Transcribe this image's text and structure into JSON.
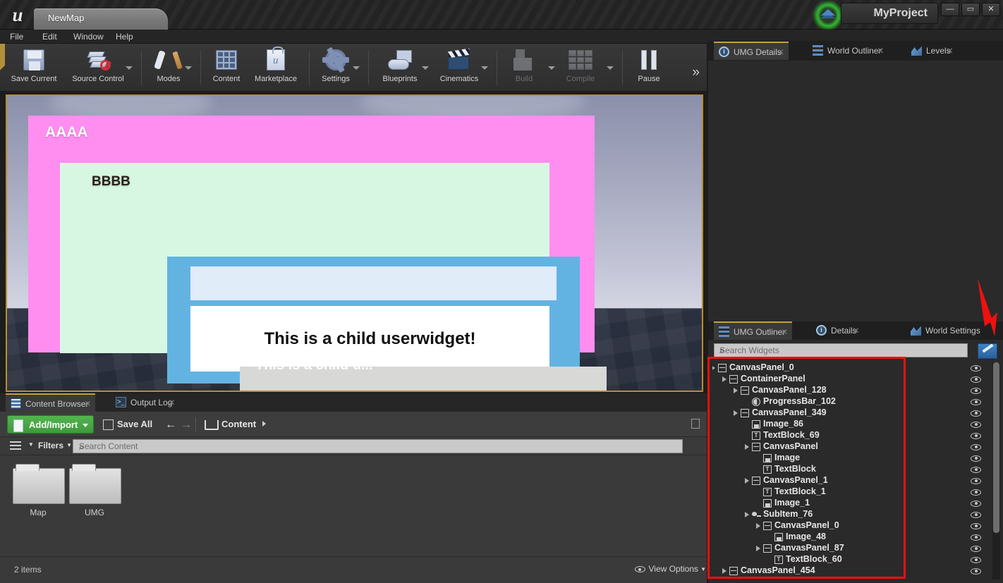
{
  "window": {
    "tab_label": "NewMap",
    "project_name": "MyProject",
    "minimize": "—",
    "maximize": "▭",
    "close": "✕"
  },
  "menu": {
    "items": [
      "File",
      "Edit",
      "Window",
      "Help"
    ]
  },
  "toolbar": {
    "items": [
      {
        "label": "Save Current",
        "icon": "save-icon",
        "disabled": false,
        "dropdown": false
      },
      {
        "label": "Source Control",
        "icon": "source-control-icon",
        "disabled": false,
        "dropdown": true
      },
      {
        "label": "Modes",
        "icon": "modes-icon",
        "disabled": false,
        "dropdown": true
      },
      {
        "label": "Content",
        "icon": "content-icon",
        "disabled": false,
        "dropdown": false
      },
      {
        "label": "Marketplace",
        "icon": "marketplace-icon",
        "disabled": false,
        "dropdown": false
      },
      {
        "label": "Settings",
        "icon": "settings-gear-icon",
        "disabled": false,
        "dropdown": true
      },
      {
        "label": "Blueprints",
        "icon": "blueprints-icon",
        "disabled": false,
        "dropdown": true
      },
      {
        "label": "Cinematics",
        "icon": "cinematics-icon",
        "disabled": false,
        "dropdown": true
      },
      {
        "label": "Build",
        "icon": "build-icon",
        "disabled": true,
        "dropdown": true
      },
      {
        "label": "Compile",
        "icon": "compile-icon",
        "disabled": true,
        "dropdown": true
      },
      {
        "label": "Pause",
        "icon": "pause-icon",
        "disabled": false,
        "dropdown": false
      }
    ],
    "overflow": "»"
  },
  "viewport": {
    "outer_label": "AAAA",
    "inner_label": "BBBB",
    "child_widget_text": "This is a child userwidget!",
    "clipped_text": "This is a child u...",
    "colors": {
      "outer_panel": "#ff8ef0",
      "inner_panel": "#d7f7e3",
      "accent_panel": "#63b3e2",
      "field_panel": "#e0ecf8",
      "border": "#b58f2c"
    }
  },
  "content_browser": {
    "tabs": [
      {
        "label": "Content Browser",
        "icon": "content-browser-icon",
        "active": true
      },
      {
        "label": "Output Log",
        "icon": "output-log-icon",
        "active": false
      }
    ],
    "add_import": "Add/Import",
    "save_all": "Save All",
    "back_arrow": "←",
    "forward_arrow": "→",
    "breadcrumb": "Content",
    "filters": "Filters",
    "search_placeholder": "Search Content",
    "assets": [
      {
        "name": "Map",
        "type": "folder"
      },
      {
        "name": "UMG",
        "type": "folder"
      }
    ],
    "item_count": "2 items",
    "view_options": "View Options"
  },
  "right_top": {
    "tabs": [
      {
        "label": "UMG Details",
        "icon": "details-icon",
        "active": true
      },
      {
        "label": "World Outliner",
        "icon": "outliner-icon",
        "active": false
      },
      {
        "label": "Levels",
        "icon": "levels-icon",
        "active": false
      }
    ]
  },
  "right_bottom": {
    "tabs": [
      {
        "label": "UMG Outliner",
        "icon": "outliner-icon",
        "active": true
      },
      {
        "label": "Details",
        "icon": "details-icon",
        "active": false
      },
      {
        "label": "World Settings",
        "icon": "world-settings-icon",
        "active": false
      }
    ],
    "search_placeholder": "Search Widgets",
    "picker_button": "eyedropper-icon",
    "tree": [
      {
        "label": "CanvasPanel_0",
        "depth": 0,
        "icon": "canvas-panel-icon",
        "expandable": true
      },
      {
        "label": "ContainerPanel",
        "depth": 1,
        "icon": "canvas-panel-icon",
        "expandable": true
      },
      {
        "label": "CanvasPanel_128",
        "depth": 2,
        "icon": "canvas-panel-icon",
        "expandable": true
      },
      {
        "label": "ProgressBar_102",
        "depth": 3,
        "icon": "progress-bar-icon",
        "expandable": false
      },
      {
        "label": "CanvasPanel_349",
        "depth": 2,
        "icon": "canvas-panel-icon",
        "expandable": true
      },
      {
        "label": "Image_86",
        "depth": 3,
        "icon": "image-icon",
        "expandable": false
      },
      {
        "label": "TextBlock_69",
        "depth": 3,
        "icon": "text-block-icon",
        "expandable": false
      },
      {
        "label": "CanvasPanel",
        "depth": 3,
        "icon": "canvas-panel-icon",
        "expandable": true
      },
      {
        "label": "Image",
        "depth": 4,
        "icon": "image-icon",
        "expandable": false
      },
      {
        "label": "TextBlock",
        "depth": 4,
        "icon": "text-block-icon",
        "expandable": false
      },
      {
        "label": "CanvasPanel_1",
        "depth": 3,
        "icon": "canvas-panel-icon",
        "expandable": true
      },
      {
        "label": "TextBlock_1",
        "depth": 4,
        "icon": "text-block-icon",
        "expandable": false
      },
      {
        "label": "Image_1",
        "depth": 4,
        "icon": "image-icon",
        "expandable": false
      },
      {
        "label": "SubItem_76",
        "depth": 3,
        "icon": "sub-item-icon",
        "expandable": true
      },
      {
        "label": "CanvasPanel_0",
        "depth": 4,
        "icon": "canvas-panel-icon",
        "expandable": true
      },
      {
        "label": "Image_48",
        "depth": 5,
        "icon": "image-icon",
        "expandable": false
      },
      {
        "label": "CanvasPanel_87",
        "depth": 4,
        "icon": "canvas-panel-icon",
        "expandable": true
      },
      {
        "label": "TextBlock_60",
        "depth": 5,
        "icon": "text-block-icon",
        "expandable": false
      },
      {
        "label": "CanvasPanel_454",
        "depth": 1,
        "icon": "canvas-panel-icon",
        "expandable": true
      }
    ]
  },
  "annotations": {
    "highlight_color": "#f01010",
    "arrow": "down-arrow-annotation",
    "rect": "outliner-highlight-rect"
  }
}
